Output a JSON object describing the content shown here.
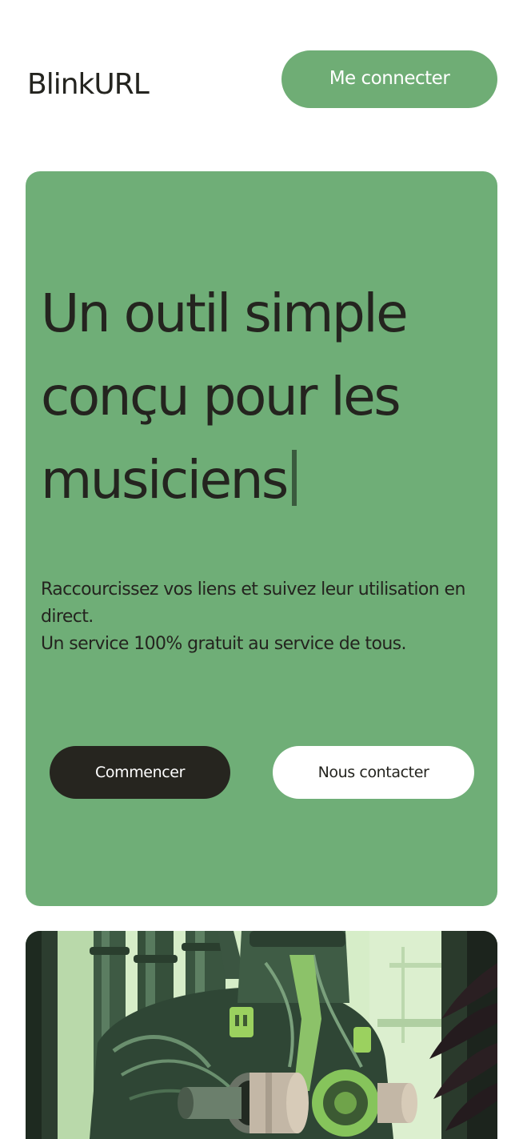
{
  "header": {
    "logo": "BlinkURL",
    "login_label": "Me connecter"
  },
  "hero": {
    "title_line1": "Un outil simple",
    "title_line2": "conçu pour les",
    "title_line3": "musiciens",
    "description_line1": "Raccourcissez vos liens et suivez leur utilisation en direct.",
    "description_line2": "Un service 100% gratuit au service de tous.",
    "primary_cta": "Commencer",
    "secondary_cta": "Nous contacter"
  },
  "colors": {
    "accent_green": "#6fae77",
    "dark": "#26251f",
    "white": "#ffffff"
  }
}
